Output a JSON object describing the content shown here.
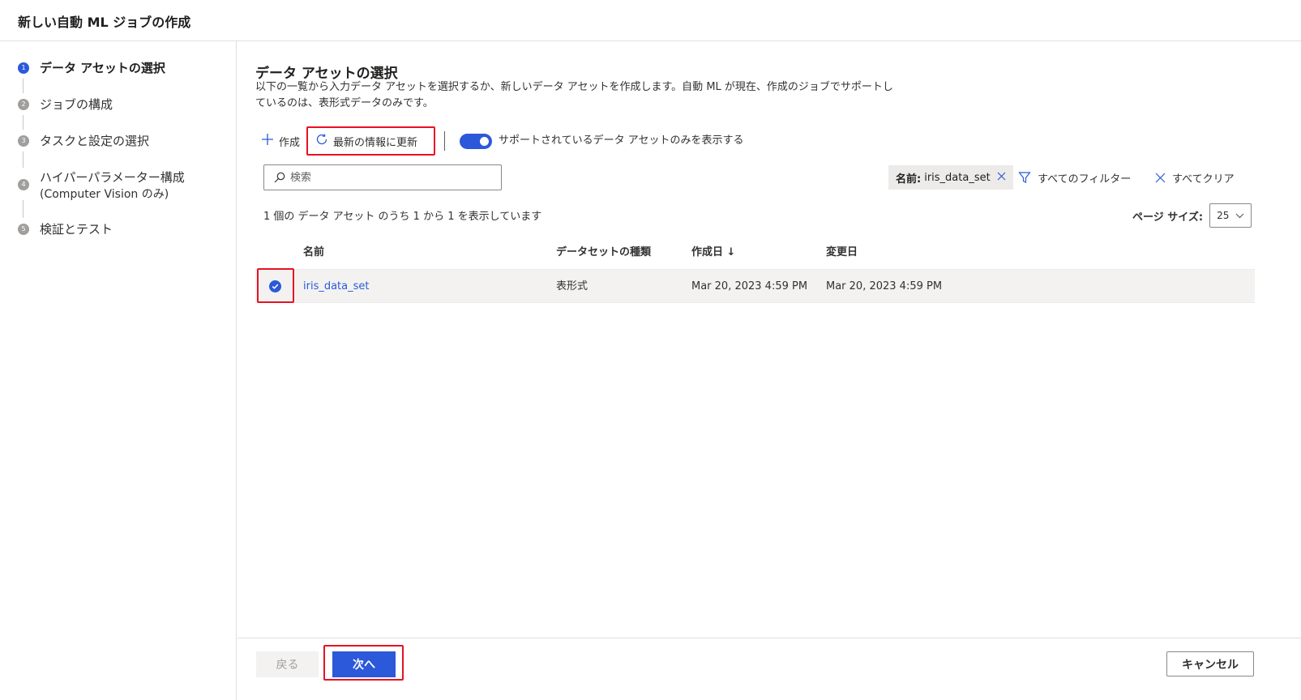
{
  "app": {
    "title": "新しい自動 ML ジョブの作成"
  },
  "steps": [
    {
      "num": "1",
      "label": "データ アセットの選択",
      "sub": "",
      "active": true
    },
    {
      "num": "2",
      "label": "ジョブの構成",
      "sub": "",
      "active": false
    },
    {
      "num": "3",
      "label": "タスクと設定の選択",
      "sub": "",
      "active": false
    },
    {
      "num": "4",
      "label": "ハイパーパラメーター構成",
      "sub": "(Computer Vision のみ)",
      "active": false
    },
    {
      "num": "5",
      "label": "検証とテスト",
      "sub": "",
      "active": false
    }
  ],
  "main": {
    "title": "データ アセットの選択",
    "description": "以下の一覧から入力データ アセットを選択するか、新しいデータ アセットを作成します。自動 ML が現在、作成のジョブでサポートしているのは、表形式データのみです。"
  },
  "toolbar": {
    "create_label": "作成",
    "refresh_label": "最新の情報に更新",
    "toggle_label": "サポートされているデータ アセットのみを表示する",
    "toggle_on": true
  },
  "search": {
    "placeholder": "検索"
  },
  "filters": {
    "chip_key": "名前:",
    "chip_value": "iris_data_set",
    "all_filters_label": "すべてのフィルター",
    "clear_all_label": "すべてクリア"
  },
  "list": {
    "count_text": "1 個の データ アセット のうち 1 から 1 を表示しています",
    "page_size_label": "ページ サイズ:",
    "page_size_value": "25"
  },
  "table": {
    "columns": [
      "名前",
      "データセットの種類",
      "作成日 ↓",
      "変更日"
    ],
    "rows": [
      {
        "name": "iris_data_set",
        "type": "表形式",
        "created": "Mar 20, 2023 4:59 PM",
        "modified": "Mar 20, 2023 4:59 PM",
        "selected": true
      }
    ]
  },
  "footer": {
    "back_label": "戻る",
    "next_label": "次へ",
    "cancel_label": "キャンセル"
  },
  "colors": {
    "accent": "#2b59d9",
    "highlight_box": "#e81123",
    "selected_row": "#f3f2f1"
  }
}
